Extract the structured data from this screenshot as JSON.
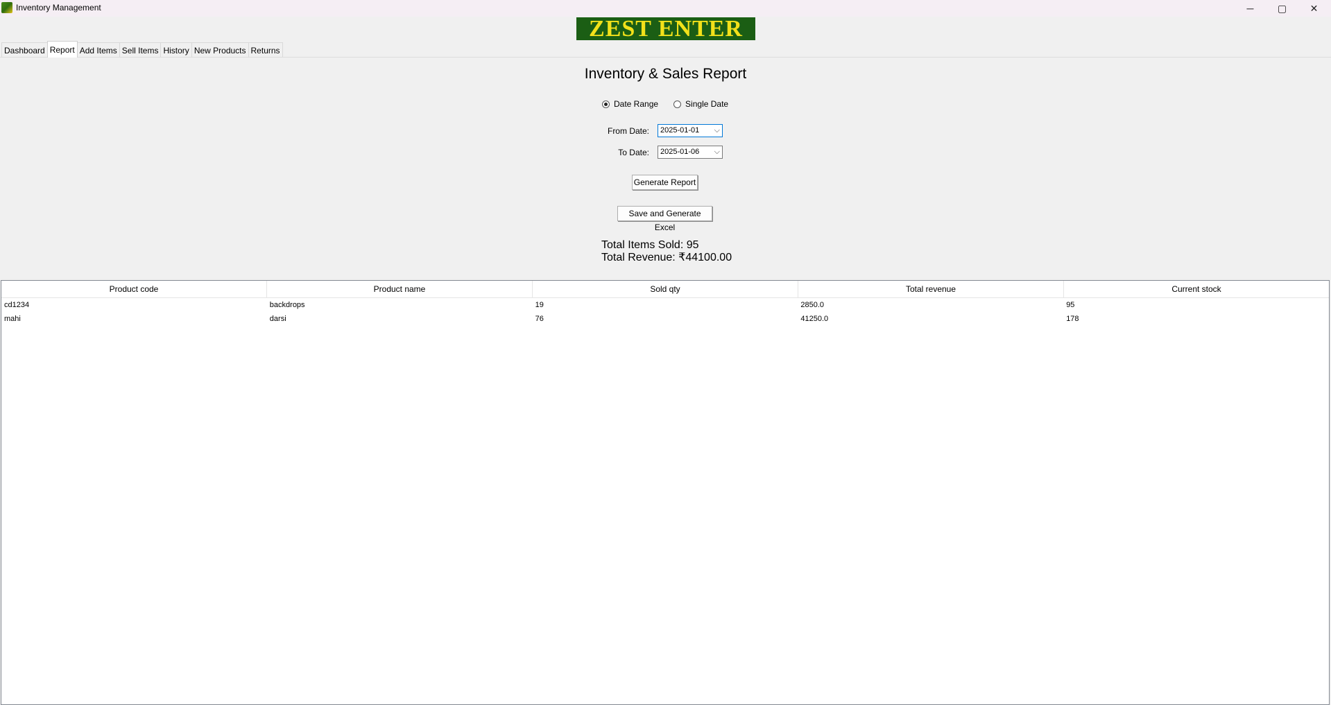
{
  "window": {
    "title": "Inventory Management",
    "controls": {
      "minimize": "─",
      "maximize": "▢",
      "close": "✕"
    }
  },
  "logo": {
    "text": "ZEST ENTER"
  },
  "tabs": [
    {
      "label": "Dashboard"
    },
    {
      "label": "Report",
      "active": true
    },
    {
      "label": "Add Items"
    },
    {
      "label": "Sell Items"
    },
    {
      "label": "History"
    },
    {
      "label": "New Products"
    },
    {
      "label": "Returns"
    }
  ],
  "report": {
    "title": "Inventory & Sales Report",
    "mode_options": [
      {
        "label": "Date Range",
        "selected": true
      },
      {
        "label": "Single Date",
        "selected": false
      }
    ],
    "from_label": "From Date:",
    "from_value": "2025-01-01",
    "to_label": "To Date:",
    "to_value": "2025-01-06",
    "generate_label": "Generate Report",
    "excel_label": "Save and Generate Excel",
    "total_items": "Total Items Sold: 95",
    "total_revenue": "Total Revenue: ₹44100.00"
  },
  "table": {
    "columns": [
      "Product code",
      "Product name",
      "Sold qty",
      "Total revenue",
      "Current stock"
    ],
    "rows": [
      [
        "cd1234",
        "backdrops",
        "19",
        "2850.0",
        "95"
      ],
      [
        "mahi",
        "darsi",
        "76",
        "41250.0",
        "178"
      ]
    ]
  },
  "icons": {
    "app": "app-logo-icon",
    "dropdown": "chevron-down-icon"
  }
}
